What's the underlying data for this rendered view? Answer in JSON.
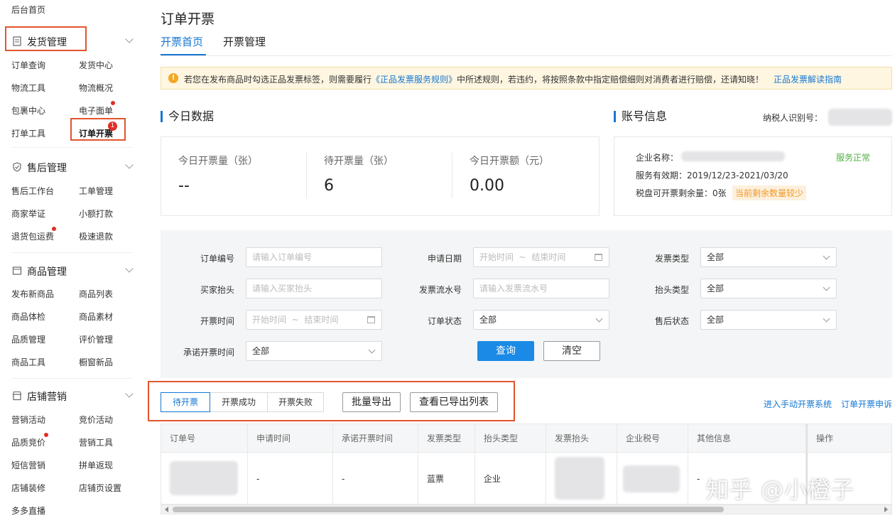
{
  "sidebar": {
    "home": "后台首页",
    "sections": [
      {
        "title": "发货管理",
        "icon": "document-icon",
        "items": [
          "订单查询",
          "发货中心",
          "物流工具",
          "物流概况",
          "包裹中心",
          "电子面单",
          "打单工具",
          "订单开票"
        ]
      },
      {
        "title": "售后管理",
        "icon": "shield-icon",
        "items": [
          "售后工作台",
          "工单管理",
          "商家举证",
          "小额打款",
          "退货包运费",
          "极速退款"
        ]
      },
      {
        "title": "商品管理",
        "icon": "box-icon",
        "items": [
          "发布新商品",
          "商品列表",
          "商品体检",
          "商品素材",
          "品质管理",
          "评价管理",
          "商品工具",
          "橱窗新品"
        ]
      },
      {
        "title": "店铺营销",
        "icon": "store-icon",
        "items": [
          "营销活动",
          "竞价活动",
          "品质竞价",
          "营销工具",
          "短信营销",
          "拼单返现",
          "店铺装修",
          "店铺页设置",
          "多多直播"
        ]
      }
    ],
    "active_badge": "1"
  },
  "page": {
    "title": "订单开票",
    "tabs": [
      "开票首页",
      "开票管理"
    ]
  },
  "notice": {
    "text_before": "若您在发布商品时勾选正品发票标签，则需要履行",
    "link": "《正品发票服务规则》",
    "text_after": "中所述规则，若违约，将按照条款中指定赔偿细则对消费者进行赔偿，还请知晓！",
    "guide": "正品发票解读指南"
  },
  "today": {
    "title": "今日数据",
    "stats": [
      {
        "label": "今日开票量（张）",
        "value": "--"
      },
      {
        "label": "待开票量（张）",
        "value": "6"
      },
      {
        "label": "今日开票额（元）",
        "value": "0.00"
      }
    ]
  },
  "account": {
    "title": "账号信息",
    "tax_id_label": "纳税人识别号：",
    "company_label": "企业名称：",
    "service_status": "服务正常",
    "validity_label": "服务有效期：",
    "validity": "2019/12/23-2021/03/20",
    "remaining_label": "税盘可开票剩余量：",
    "remaining": "0张",
    "remaining_warning": "当前剩余数量较少"
  },
  "filters": {
    "order_no": {
      "label": "订单编号",
      "placeholder": "请输入订单编号"
    },
    "apply_date": {
      "label": "申请日期",
      "start": "开始时间",
      "sep": "~",
      "end": "结束时间"
    },
    "invoice_type": {
      "label": "发票类型",
      "value": "全部"
    },
    "buyer_title": {
      "label": "买家抬头",
      "placeholder": "请输入买家抬头"
    },
    "invoice_serial": {
      "label": "发票流水号",
      "placeholder": "请输入发票流水号"
    },
    "title_type": {
      "label": "抬头类型",
      "value": "全部"
    },
    "issue_time": {
      "label": "开票时间",
      "start": "开始时间",
      "sep": "~",
      "end": "结束时间"
    },
    "order_status": {
      "label": "订单状态",
      "value": "全部"
    },
    "aftersale_status": {
      "label": "售后状态",
      "value": "全部"
    },
    "promised_time": {
      "label": "承诺开票时间",
      "value": "全部"
    },
    "query_button": "查询",
    "clear_button": "清空"
  },
  "list": {
    "segments": [
      "待开票",
      "开票成功",
      "开票失败"
    ],
    "batch_export": "批量导出",
    "view_exported": "查看已导出列表",
    "manual_system_link": "进入手动开票系统",
    "appeal_link": "订单开票申诉",
    "columns": [
      "订单号",
      "申请时间",
      "承诺开票时间",
      "发票类型",
      "抬头类型",
      "发票抬头",
      "企业税号",
      "其他信息",
      "操作"
    ],
    "rows": [
      {
        "apply_time": "-",
        "promised_time": "-",
        "invoice_type": "蓝票",
        "title_type": "企业",
        "other": "-",
        "action": "-"
      }
    ]
  },
  "watermark": "知乎 @小橙子",
  "colors": {
    "accent": "#1677d2",
    "highlight_box": "#e0552c",
    "badge": "#e02e24",
    "ok": "#52b043",
    "warn": "#f09a29"
  }
}
